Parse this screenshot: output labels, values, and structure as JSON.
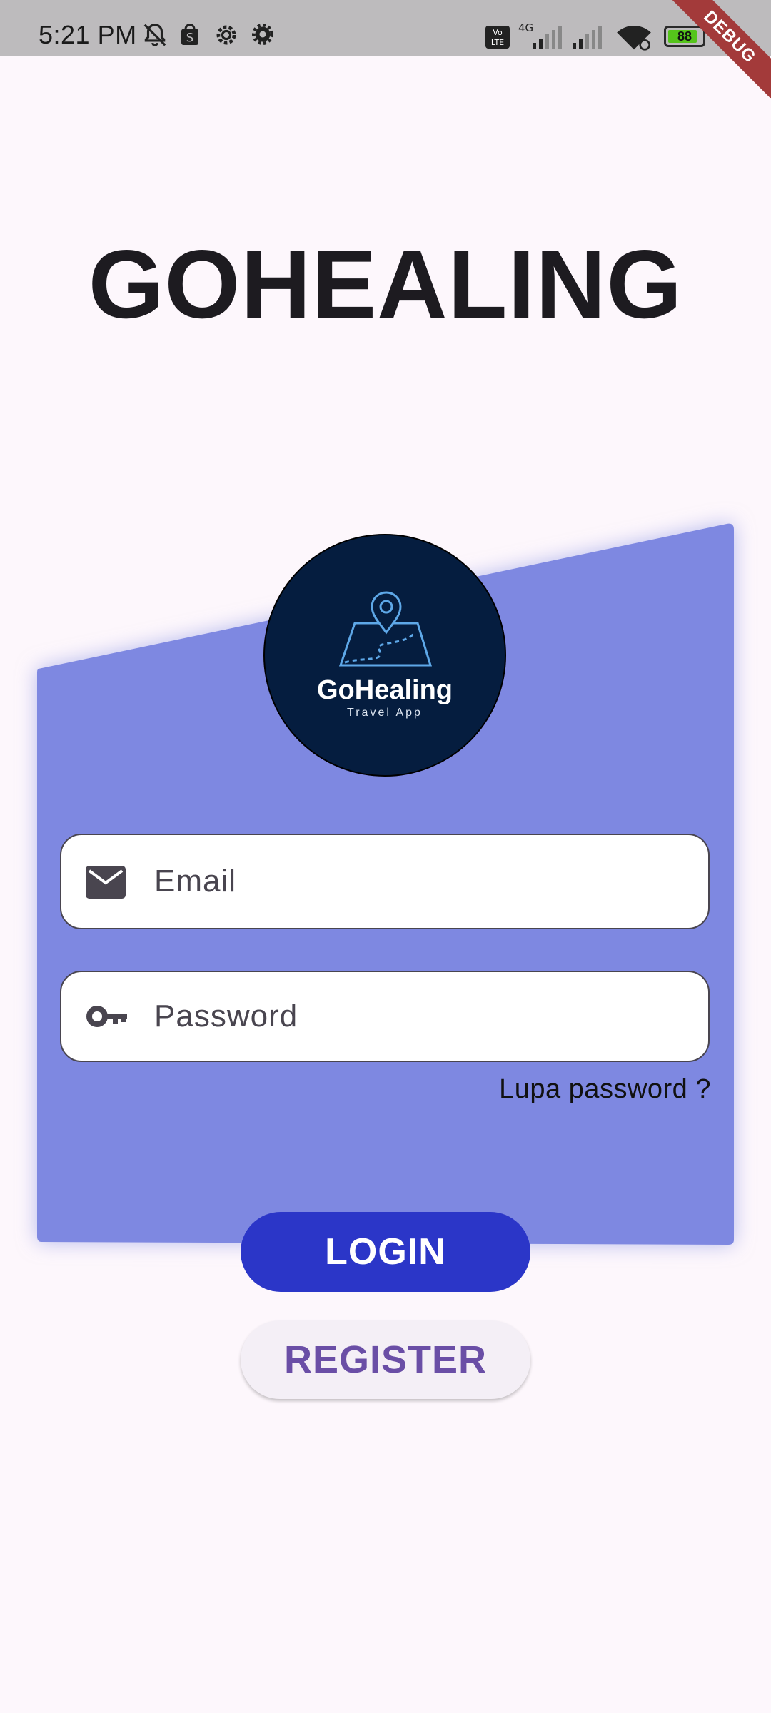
{
  "status_bar": {
    "time": "5:21 PM",
    "network": "4G",
    "volte": "Vo LTE",
    "battery_percent": "88",
    "battery_level": 0.88,
    "debug_label": "DEBUG"
  },
  "title": "GOHEALING",
  "logo": {
    "name": "GoHealing",
    "tagline": "Travel App"
  },
  "form": {
    "email_placeholder": "Email",
    "email_value": "",
    "password_placeholder": "Password",
    "password_value": "",
    "forgot_password": "Lupa password ?"
  },
  "buttons": {
    "login": "LOGIN",
    "register": "REGISTER"
  },
  "colors": {
    "card": "#7e88e1",
    "login_button": "#2b36c8",
    "logo_background": "#051d3f",
    "register_text": "#6a4ea6"
  },
  "icons": {
    "email": "mail-icon",
    "password": "key-icon"
  }
}
